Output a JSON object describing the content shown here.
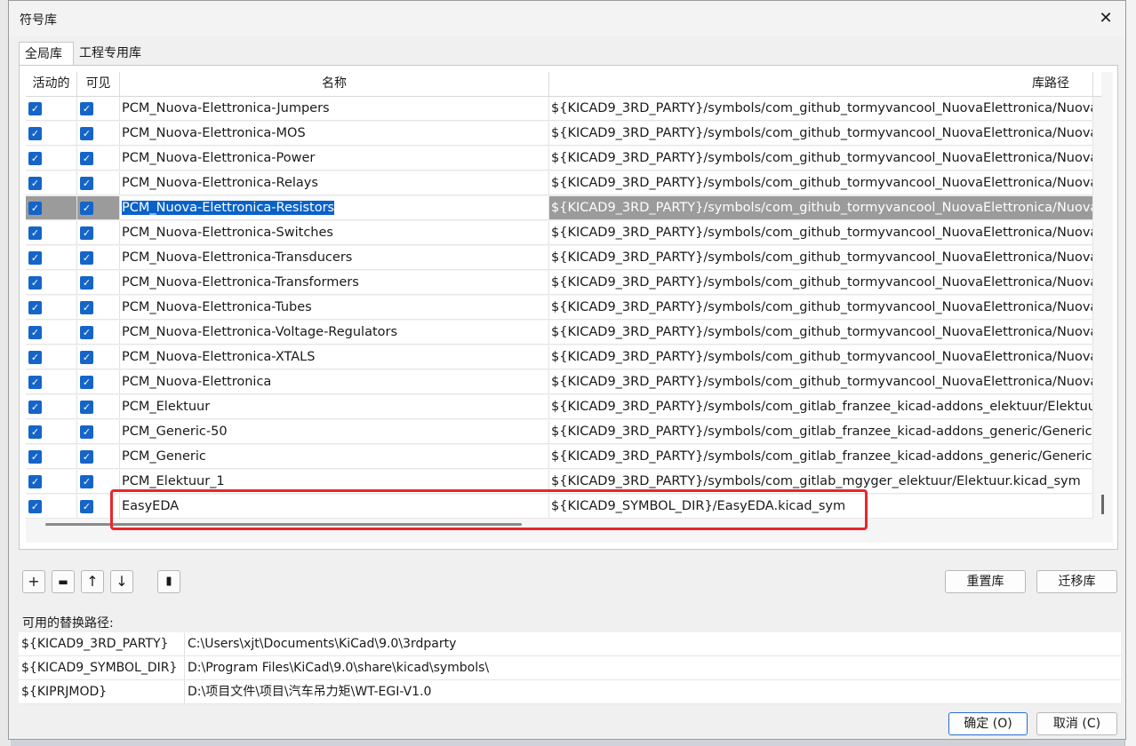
{
  "dialog": {
    "title": "符号库",
    "close_glyph": "✕"
  },
  "tabs": [
    {
      "label": "全局库"
    },
    {
      "label": "工程专用库"
    }
  ],
  "table": {
    "columns": [
      "活动的",
      "可见",
      "名称",
      "库路径"
    ],
    "rows": [
      {
        "name": "PCM_Nuova-Elettronica-Jumpers",
        "path": "${KICAD9_3RD_PARTY}/symbols/com_github_tormyvancool_NuovaElettronica/Nuova",
        "active": true,
        "visible": true
      },
      {
        "name": "PCM_Nuova-Elettronica-MOS",
        "path": "${KICAD9_3RD_PARTY}/symbols/com_github_tormyvancool_NuovaElettronica/Nuova",
        "active": true,
        "visible": true
      },
      {
        "name": "PCM_Nuova-Elettronica-Power",
        "path": "${KICAD9_3RD_PARTY}/symbols/com_github_tormyvancool_NuovaElettronica/Nuova",
        "active": true,
        "visible": true
      },
      {
        "name": "PCM_Nuova-Elettronica-Relays",
        "path": "${KICAD9_3RD_PARTY}/symbols/com_github_tormyvancool_NuovaElettronica/Nuova",
        "active": true,
        "visible": true
      },
      {
        "name": "PCM_Nuova-Elettronica-Resistors",
        "path": "${KICAD9_3RD_PARTY}/symbols/com_github_tormyvancool_NuovaElettronica/Nuova",
        "active": true,
        "visible": true,
        "selected": true
      },
      {
        "name": "PCM_Nuova-Elettronica-Switches",
        "path": "${KICAD9_3RD_PARTY}/symbols/com_github_tormyvancool_NuovaElettronica/Nuova",
        "active": true,
        "visible": true
      },
      {
        "name": "PCM_Nuova-Elettronica-Transducers",
        "path": "${KICAD9_3RD_PARTY}/symbols/com_github_tormyvancool_NuovaElettronica/Nuova",
        "active": true,
        "visible": true
      },
      {
        "name": "PCM_Nuova-Elettronica-Transformers",
        "path": "${KICAD9_3RD_PARTY}/symbols/com_github_tormyvancool_NuovaElettronica/Nuova",
        "active": true,
        "visible": true
      },
      {
        "name": "PCM_Nuova-Elettronica-Tubes",
        "path": "${KICAD9_3RD_PARTY}/symbols/com_github_tormyvancool_NuovaElettronica/Nuova",
        "active": true,
        "visible": true
      },
      {
        "name": "PCM_Nuova-Elettronica-Voltage-Regulators",
        "path": "${KICAD9_3RD_PARTY}/symbols/com_github_tormyvancool_NuovaElettronica/Nuova",
        "active": true,
        "visible": true
      },
      {
        "name": "PCM_Nuova-Elettronica-XTALS",
        "path": "${KICAD9_3RD_PARTY}/symbols/com_github_tormyvancool_NuovaElettronica/Nuova",
        "active": true,
        "visible": true
      },
      {
        "name": "PCM_Nuova-Elettronica",
        "path": "${KICAD9_3RD_PARTY}/symbols/com_github_tormyvancool_NuovaElettronica/Nuova",
        "active": true,
        "visible": true
      },
      {
        "name": "PCM_Elektuur",
        "path": "${KICAD9_3RD_PARTY}/symbols/com_gitlab_franzee_kicad-addons_elektuur/Elektuu",
        "active": true,
        "visible": true
      },
      {
        "name": "PCM_Generic-50",
        "path": "${KICAD9_3RD_PARTY}/symbols/com_gitlab_franzee_kicad-addons_generic/Generic-",
        "active": true,
        "visible": true
      },
      {
        "name": "PCM_Generic",
        "path": "${KICAD9_3RD_PARTY}/symbols/com_gitlab_franzee_kicad-addons_generic/Generic.",
        "active": true,
        "visible": true
      },
      {
        "name": "PCM_Elektuur_1",
        "path": "${KICAD9_3RD_PARTY}/symbols/com_gitlab_mgyger_elektuur/Elektuur.kicad_sym",
        "active": true,
        "visible": true
      },
      {
        "name": "EasyEDA",
        "path": "${KICAD9_SYMBOL_DIR}/EasyEDA.kicad_sym",
        "active": true,
        "visible": true,
        "highlighted": true
      }
    ]
  },
  "toolbar": {
    "add_glyph": "+",
    "folder_glyph": "▬",
    "up_glyph": "↑",
    "down_glyph": "↓",
    "delete_glyph": "▮",
    "reset_label": "重置库",
    "migrate_label": "迁移库"
  },
  "substitutions": {
    "label": "可用的替换路径:",
    "rows": [
      {
        "key": "${KICAD9_3RD_PARTY}",
        "value": "C:\\Users\\xjt\\Documents\\KiCad\\9.0\\3rdparty"
      },
      {
        "key": "${KICAD9_SYMBOL_DIR}",
        "value": "D:\\Program Files\\KiCad\\9.0\\share\\kicad\\symbols\\"
      },
      {
        "key": "${KIPRJMOD}",
        "value": "D:\\项目文件\\项目\\汽车吊力矩\\WT-EGI-V1.0"
      }
    ]
  },
  "footer": {
    "ok_label": "确定 (O)",
    "cancel_label": "取消 (C)"
  },
  "colors": {
    "accent": "#1565c8",
    "selection": "#0a62c9",
    "highlight_box": "#e8262a"
  }
}
